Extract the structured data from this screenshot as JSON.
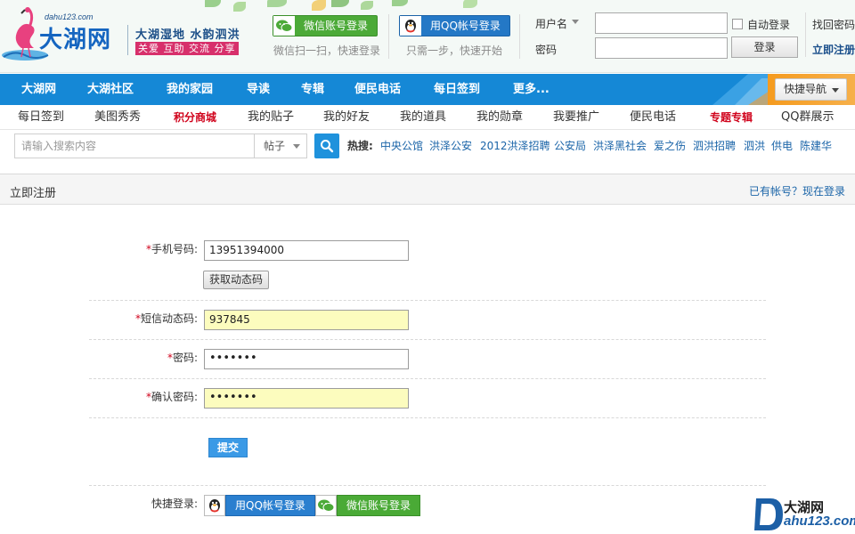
{
  "header": {
    "logo_domain": "dahu123.com",
    "logo_name": "大湖网",
    "slogan_main": "大湖湿地 水韵泗洪",
    "slogan_sub": "关爱 互助 交流 分享",
    "wechat_login_label": "微信账号登录",
    "wechat_login_tip": "微信扫一扫，快速登录",
    "qq_login_label": "用QQ帐号登录",
    "qq_login_tip": "只需一步，快速开始",
    "username_label": "用户名",
    "password_label": "密码",
    "auto_login_label": "自动登录",
    "login_button": "登录",
    "find_password": "找回密码",
    "register_now": "立即注册"
  },
  "main_nav": {
    "items": [
      "大湖网",
      "大湖社区",
      "我的家园",
      "导读",
      "专辑",
      "便民电话",
      "每日签到",
      "更多..."
    ],
    "quick_nav": "快捷导航"
  },
  "sub_nav": {
    "items": [
      "每日签到",
      "美图秀秀",
      "积分商城",
      "我的贴子",
      "我的好友",
      "我的道具",
      "我的勋章",
      "我要推广",
      "便民电话",
      "专题专辑",
      "QQ群展示"
    ]
  },
  "search": {
    "placeholder": "请输入搜索内容",
    "type": "帖子",
    "hot_label": "热搜:",
    "hot_items": [
      "中央公馆",
      "洪泽公安",
      "2012洪泽招聘",
      "公安局",
      "洪泽黑社会",
      "爱之伤",
      "泗洪招聘",
      "泗洪",
      "供电",
      "陈建华"
    ]
  },
  "register": {
    "title": "立即注册",
    "have_account": "已有帐号？现在登录",
    "required_mark": "*",
    "phone_label": "手机号码:",
    "phone_value": "13951394000",
    "get_code_button": "获取动态码",
    "sms_label": "短信动态码:",
    "sms_value": "937845",
    "password_label": "密码:",
    "password_value": "•••••••",
    "confirm_label": "确认密码:",
    "confirm_value": "•••••••",
    "submit_button": "提交",
    "quick_login_label": "快捷登录:",
    "quick_qq": "用QQ帐号登录",
    "quick_wechat": "微信账号登录"
  },
  "watermark": {
    "name": "大湖网",
    "domain": "ahu123.com"
  },
  "colors": {
    "nav_blue": "#1588d6",
    "link_blue": "#1a64a8",
    "accent_red": "#d0021b",
    "wechat_green": "#4caa38",
    "qq_blue": "#2478c6",
    "autofill_yellow": "#fcfcbe"
  }
}
